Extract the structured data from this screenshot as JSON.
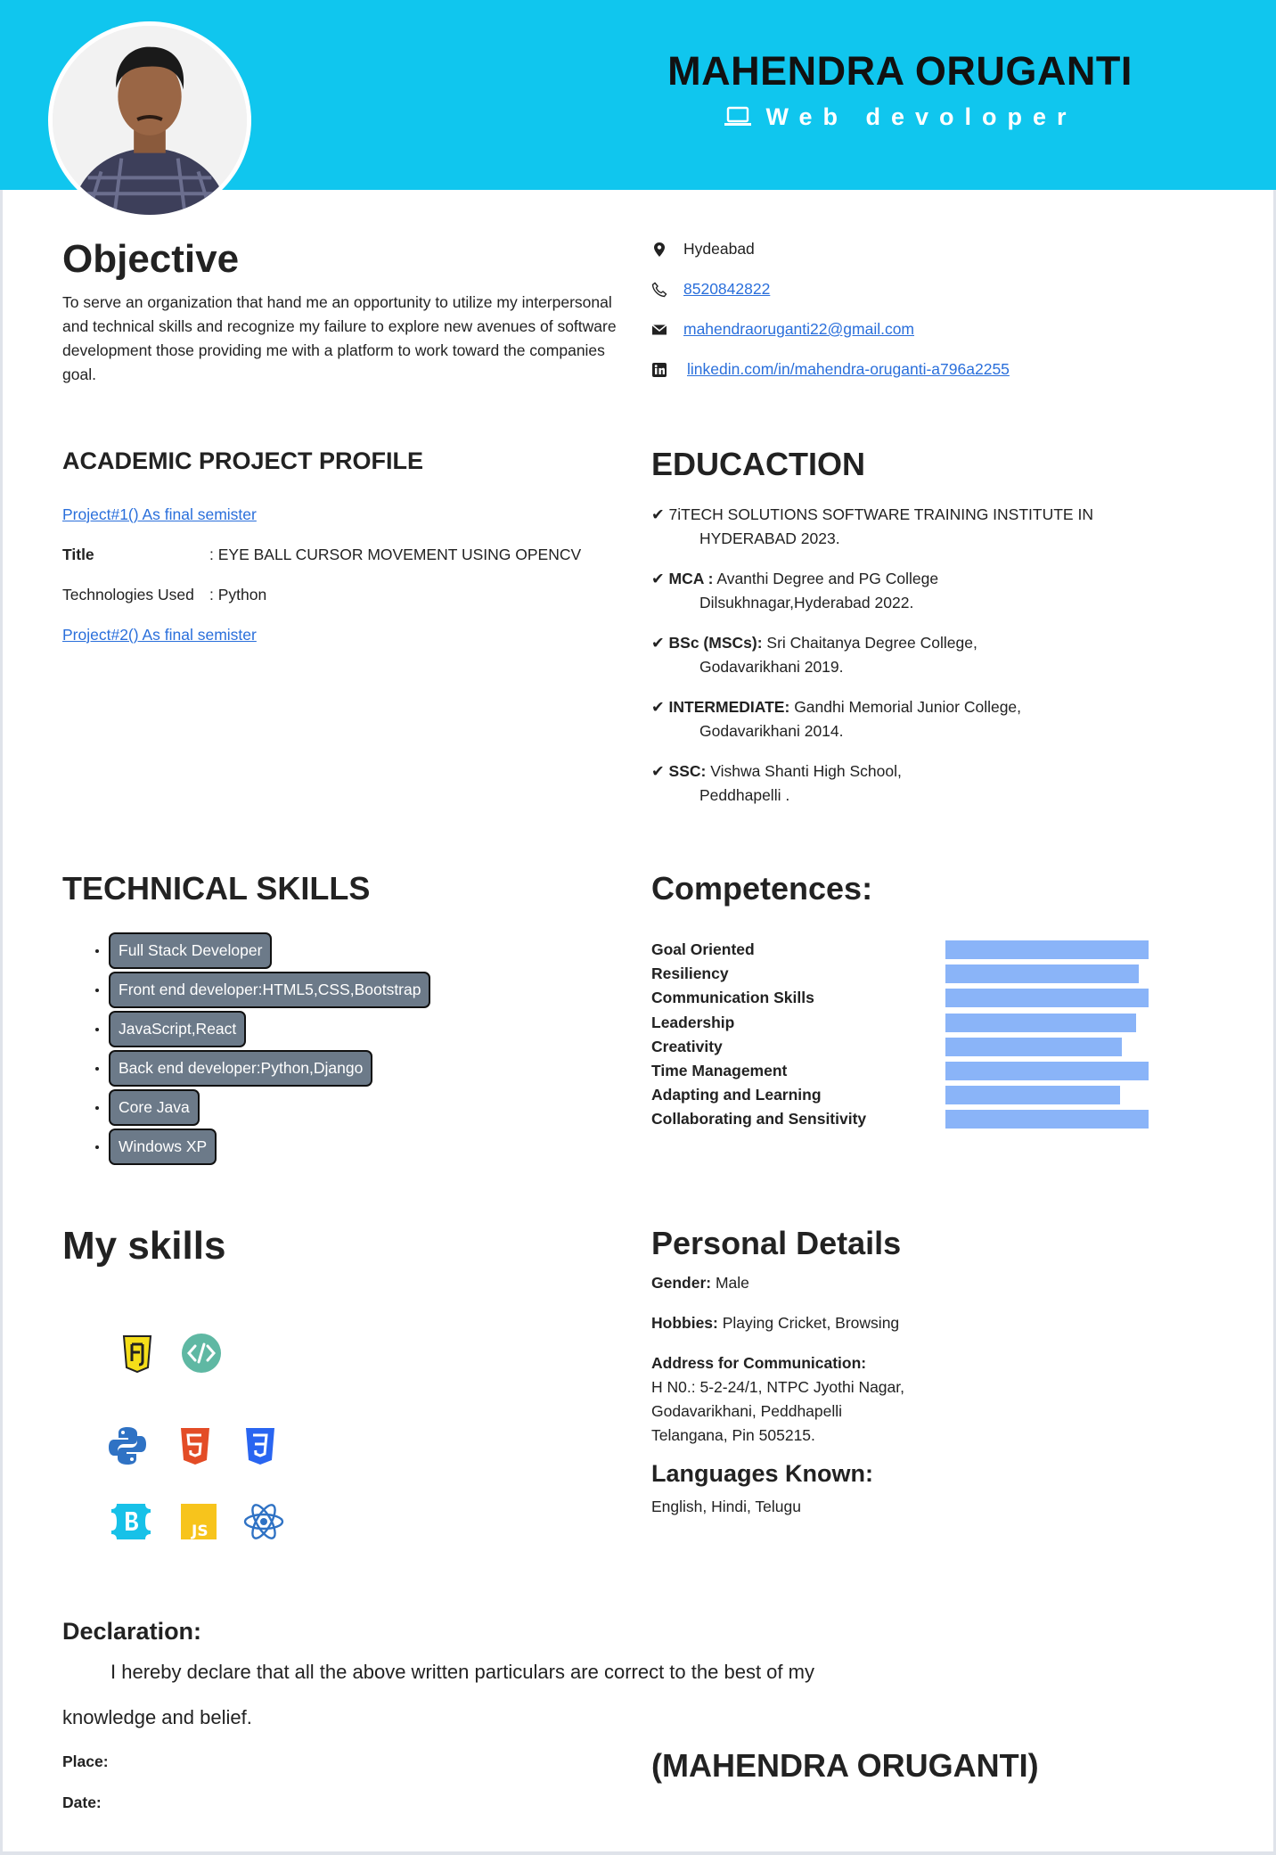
{
  "header": {
    "name": "MAHENDRA ORUGANTI",
    "role": "Web devoloper",
    "role_icon": "laptop-icon",
    "bg_color": "#10c6ee"
  },
  "objective": {
    "title": "Objective",
    "text": "To serve an organization that hand me an opportunity to utilize my interpersonal and technical skills and recognize my failure to explore new avenues of software development those providing me with a platform to work toward the companies goal."
  },
  "contact": {
    "location": "Hydeabad",
    "phone": "8520842822",
    "email": "mahendraoruganti22@gmail.com",
    "linkedin": "linkedin.com/in/mahendra-oruganti-a796a2255"
  },
  "projects": {
    "title": "ACADEMIC PROJECT PROFILE",
    "project1_link": "Project#1() As final semister",
    "title_key": "Title",
    "title_value": ": EYE BALL CURSOR MOVEMENT USING OPENCV",
    "tech_key": "Technologies Used",
    "tech_value": ": Python",
    "project2_link": "Project#2() As final semister"
  },
  "education": {
    "title": "EDUCACTION",
    "items": [
      {
        "label": "",
        "line1": "7iTECH SOLUTIONS SOFTWARE TRAINING INSTITUTE IN",
        "line2": "HYDERABAD 2023."
      },
      {
        "label": "MCA :",
        "line1": "Avanthi Degree and PG College",
        "line2": "Dilsukhnagar,Hyderabad 2022."
      },
      {
        "label": "BSc (MSCs):",
        "line1": "Sri Chaitanya Degree College,",
        "line2": "Godavarikhani 2019."
      },
      {
        "label": "INTERMEDIATE:",
        "line1": "Gandhi Memorial Junior College,",
        "line2": "Godavarikhani 2014."
      },
      {
        "label": "SSC:",
        "line1": "Vishwa Shanti High School,",
        "line2": "Peddhapelli ."
      }
    ]
  },
  "technical_skills": {
    "title": "TECHNICAL SKILLS",
    "items": [
      "Full Stack Developer",
      "Front end developer:HTML5,CSS,Bootstrap",
      "JavaScript,React",
      "Back end developer:Python,Django",
      "Core Java",
      "Windows XP"
    ]
  },
  "competences": {
    "title": "Competences:",
    "bar_color": "#8ab4f8",
    "items": [
      {
        "label": "Goal Oriented",
        "level": 1.0
      },
      {
        "label": "Resiliency",
        "level": 0.95
      },
      {
        "label": "Communication Skills",
        "level": 1.0
      },
      {
        "label": "Leadership",
        "level": 0.94
      },
      {
        "label": "Creativity",
        "level": 0.87
      },
      {
        "label": "Time Management",
        "level": 1.0
      },
      {
        "label": "Adapting and Learning",
        "level": 0.86
      },
      {
        "label": "Collaborating and Sensitivity",
        "level": 1.0
      }
    ]
  },
  "my_skills": {
    "title": "My skills",
    "icons": [
      "java-icon",
      "code-icon",
      "python-icon",
      "html5-icon",
      "css3-icon",
      "bootstrap-icon",
      "javascript-icon",
      "react-icon"
    ]
  },
  "personal": {
    "title": "Personal Details",
    "gender_label": "Gender:",
    "gender": "Male",
    "hobbies_label": "Hobbies:",
    "hobbies": "Playing Cricket, Browsing",
    "address_label": "Address for Communication:",
    "address_line1": "H N0.: 5-2-24/1, NTPC Jyothi Nagar,",
    "address_line2": "Godavarikhani, Peddhapelli",
    "address_line3": "Telangana, Pin 505215.",
    "languages_title": "Languages Known:",
    "languages": "English, Hindi, Telugu"
  },
  "declaration": {
    "title": "Declaration:",
    "line1": "I hereby declare that all the above written particulars are correct to the best of my",
    "line2": "knowledge and belief.",
    "place_label": "Place:",
    "date_label": "Date:",
    "signature": "(MAHENDRA ORUGANTI)"
  }
}
